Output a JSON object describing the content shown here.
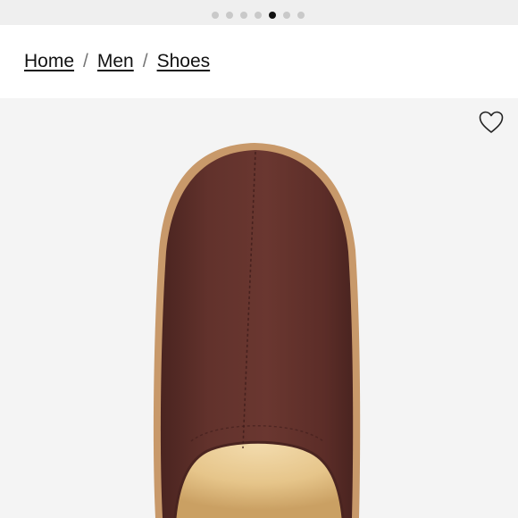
{
  "carousel": {
    "slide_count": 7,
    "active_index": 4
  },
  "breadcrumb": {
    "items": [
      {
        "label": "Home"
      },
      {
        "label": "Men"
      },
      {
        "label": "Shoes"
      }
    ],
    "separator": "/"
  },
  "product": {
    "wishlist_icon": "heart-outline-icon",
    "colors": {
      "suede": "#5e2f2a",
      "sole": "#c8996a",
      "lining": "#e8c98e",
      "background": "#f4f4f4"
    }
  }
}
